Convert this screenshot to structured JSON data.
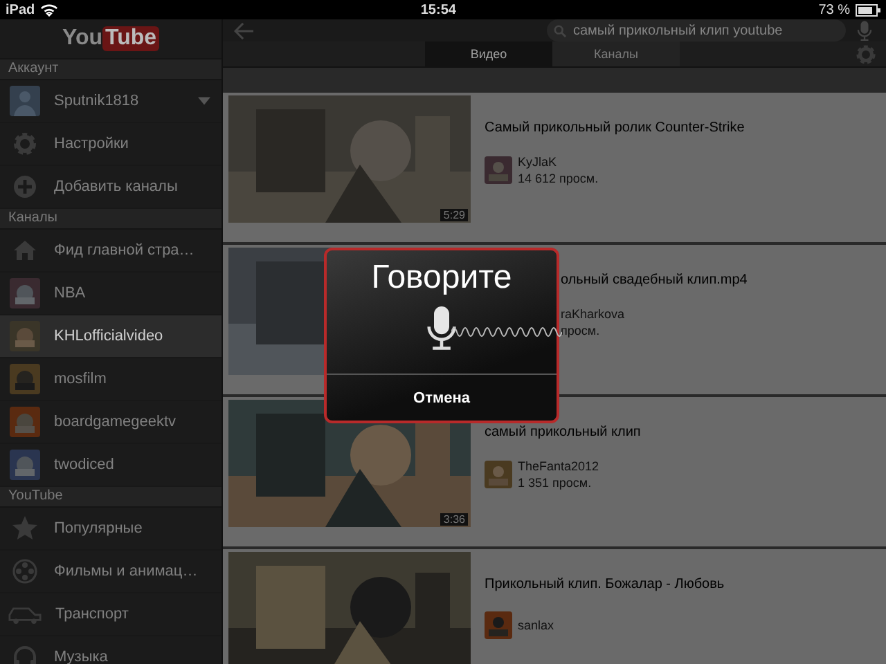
{
  "status_bar": {
    "device": "iPad",
    "time": "15:54",
    "battery": "73 %"
  },
  "sidebar": {
    "logo": {
      "first": "You",
      "second": "Tube"
    },
    "sections": [
      {
        "header": "Аккаунт",
        "items": [
          {
            "kind": "account",
            "label": "Sputnik1818",
            "selected": false
          },
          {
            "kind": "action",
            "label": "Настройки",
            "selected": false
          },
          {
            "kind": "action",
            "label": "Добавить каналы",
            "selected": false
          }
        ]
      },
      {
        "header": "Каналы",
        "items": [
          {
            "kind": "action",
            "label": "Фид главной стра…",
            "selected": false
          },
          {
            "kind": "channel",
            "label": "NBA",
            "selected": false
          },
          {
            "kind": "channel",
            "label": "KHLofficialvideo",
            "selected": true
          },
          {
            "kind": "channel",
            "label": "mosfilm",
            "selected": false
          },
          {
            "kind": "channel",
            "label": "boardgamegeektv",
            "selected": false
          },
          {
            "kind": "channel",
            "label": "twodiced",
            "selected": false
          }
        ]
      },
      {
        "header": "YouTube",
        "items": [
          {
            "kind": "action",
            "label": "Популярные",
            "selected": false
          },
          {
            "kind": "action",
            "label": "Фильмы и анимац…",
            "selected": false
          },
          {
            "kind": "action",
            "label": "Транспорт",
            "selected": false
          },
          {
            "kind": "action",
            "label": "Музыка",
            "selected": false
          }
        ]
      }
    ]
  },
  "search": {
    "value": "самый прикольный клип youtube"
  },
  "tabs": [
    {
      "label": "Видео",
      "selected": true
    },
    {
      "label": "Каналы",
      "selected": false
    }
  ],
  "videos": [
    {
      "title": "Самый прикольный ролик Counter-Strike",
      "channel": "KyJlaK",
      "views": "14 612 просм.",
      "duration": "5:29",
      "covered": false
    },
    {
      "title": "ольный свадебный клип.mp4",
      "channel": "raKharkova",
      "views": "просм.",
      "covered": true
    },
    {
      "title": "самый прикольный клип",
      "channel": "TheFanta2012",
      "views": "1 351 просм.",
      "duration": "3:36",
      "covered": false
    },
    {
      "title": "Прикольный клип. Божалар - Любовь",
      "channel": "sanlax",
      "covered": false
    }
  ],
  "dialog": {
    "title": "Говорите",
    "cancel": "Отмена"
  }
}
